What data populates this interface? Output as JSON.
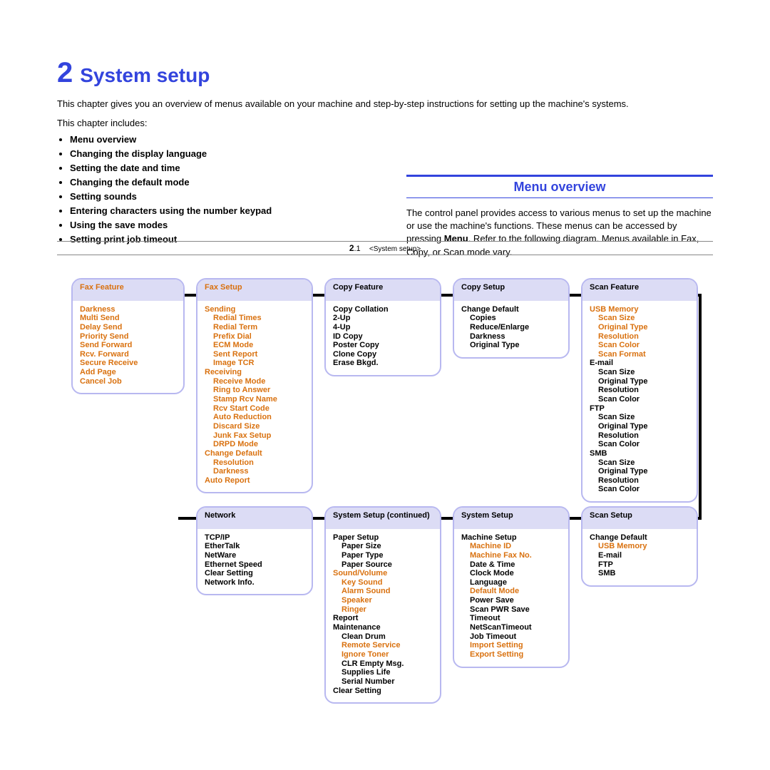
{
  "chapter": {
    "num": "2",
    "title": "System setup"
  },
  "intro": "This chapter gives you an overview of menus available on your machine and step-by-step instructions for setting up the machine's systems.",
  "includes_label": "This chapter includes:",
  "toc": [
    "Menu overview",
    "Changing the display language",
    "Setting the date and time",
    "Changing the default mode",
    "Setting sounds",
    "Entering characters using the number keypad",
    "Using the save modes",
    "Setting print job timeout"
  ],
  "section": {
    "head": "Menu overview",
    "body_pre": "The control panel provides access to various menus to set up the machine or use the machine's functions. These menus can be accessed by pressing ",
    "body_bold": "Menu",
    "body_post": ". Refer to the following diagram. Menus available in Fax, Copy, or Scan mode vary."
  },
  "boxes": {
    "fax_feature": {
      "head": "Fax Feature",
      "items": [
        "Darkness",
        "Multi Send",
        "Delay Send",
        "Priority Send",
        "Send Forward",
        "Rcv. Forward",
        "Secure Receive",
        "Add Page",
        "Cancel Job"
      ]
    },
    "fax_setup": {
      "head": "Fax Setup",
      "sending": "Sending",
      "sending_items": [
        "Redial Times",
        "Redial Term",
        "Prefix Dial",
        "ECM Mode",
        "Sent Report",
        "Image TCR"
      ],
      "receiving": "Receiving",
      "receiving_items": [
        "Receive Mode",
        "Ring to Answer",
        "Stamp Rcv Name",
        "Rcv Start Code",
        "Auto Reduction",
        "Discard Size",
        "Junk Fax Setup",
        "DRPD Mode"
      ],
      "change_default": "Change Default",
      "change_default_items": [
        "Resolution",
        "Darkness"
      ],
      "auto_report": "Auto Report"
    },
    "copy_feature": {
      "head": "Copy Feature",
      "items": [
        "Copy Collation",
        "2-Up",
        "4-Up",
        "ID Copy",
        "Poster Copy",
        "Clone Copy",
        "Erase Bkgd."
      ]
    },
    "copy_setup": {
      "head": "Copy Setup",
      "change_default": "Change Default",
      "items": [
        "Copies",
        "Reduce/Enlarge",
        "Darkness",
        "Original Type"
      ]
    },
    "scan_feature": {
      "head": "Scan Feature",
      "usb": "USB Memory",
      "usb_items": [
        "Scan Size",
        "Original Type",
        "Resolution",
        "Scan Color",
        "Scan Format"
      ],
      "email": "E-mail",
      "email_items": [
        "Scan Size",
        "Original Type",
        "Resolution",
        "Scan Color"
      ],
      "ftp": "FTP",
      "ftp_items": [
        "Scan Size",
        "Original Type",
        "Resolution",
        "Scan Color"
      ],
      "smb": "SMB",
      "smb_items": [
        "Scan Size",
        "Original Type",
        "Resolution",
        "Scan Color"
      ]
    },
    "network": {
      "head": "Network",
      "items": [
        "TCP/IP",
        "EtherTalk",
        "NetWare",
        "Ethernet Speed",
        "Clear Setting",
        "Network Info."
      ]
    },
    "system_setup_cont": {
      "head": "System Setup (continued)",
      "paper_setup": "Paper Setup",
      "paper_items": [
        "Paper Size",
        "Paper Type",
        "Paper Source"
      ],
      "sound": "Sound/Volume",
      "sound_items": [
        "Key Sound",
        "Alarm Sound",
        "Speaker",
        "Ringer"
      ],
      "report": "Report",
      "maintenance": "Maintenance",
      "maint_items_k": [
        "Clean Drum"
      ],
      "maint_items_o": [
        "Remote Service",
        "Ignore Toner"
      ],
      "maint_items_k2": [
        "CLR Empty Msg.",
        "Supplies Life",
        "Serial Number"
      ],
      "clear_setting": "Clear Setting"
    },
    "system_setup": {
      "head": "System Setup",
      "machine_setup": "Machine Setup",
      "ms_o": [
        "Machine ID",
        "Machine Fax No."
      ],
      "ms_k": [
        "Date & Time",
        "Clock Mode",
        "Language"
      ],
      "ms_o2": [
        "Default Mode"
      ],
      "ms_k2": [
        "Power Save",
        "Scan PWR Save",
        "Timeout",
        "NetScanTimeout",
        "Job Timeout"
      ],
      "ms_o3": [
        "Import Setting",
        "Export Setting"
      ]
    },
    "scan_setup": {
      "head": "Scan Setup",
      "change_default": "Change Default",
      "usb_memory": "USB Memory",
      "items": [
        "E-mail",
        "FTP",
        "SMB"
      ]
    }
  },
  "footer": {
    "page": "2",
    "sub": ".1",
    "bracket": "<System setup>"
  }
}
